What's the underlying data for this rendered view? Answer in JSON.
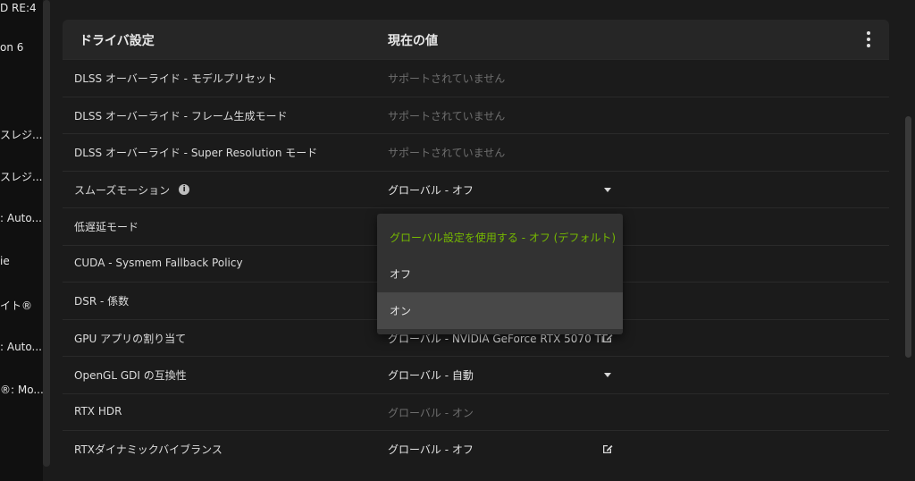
{
  "left_pane": {
    "items": [
      "D RE:4",
      "on 6",
      "スレジ...",
      "スレジ...",
      ": Auto...",
      "ie",
      "イト®",
      ": Auto...",
      "®: Mo..."
    ]
  },
  "table": {
    "header_setting": "ドライバ設定",
    "header_value": "現在の値",
    "rows": [
      {
        "label": "DLSS オーバーライド - モデルプリセット",
        "value": "サポートされていません"
      },
      {
        "label": "DLSS オーバーライド - フレーム生成モード",
        "value": "サポートされていません"
      },
      {
        "label": "DLSS オーバーライド - Super Resolution モード",
        "value": "サポートされていません"
      },
      {
        "label": "スムーズモーション",
        "value": "グローバル - オフ"
      },
      {
        "label": "低遅延モード",
        "value": ""
      },
      {
        "label": "CUDA - Sysmem Fallback Policy",
        "value": ""
      },
      {
        "label": "DSR - 係数",
        "value": ""
      },
      {
        "label": "GPU アプリの割り当て",
        "value": "グローバル - NVIDIA GeForce RTX 5070 Ti"
      },
      {
        "label": "OpenGL GDI の互換性",
        "value": "グローバル - 自動"
      },
      {
        "label": "RTX HDR",
        "value": "グローバル - オン"
      },
      {
        "label": "RTXダイナミックバイブランス",
        "value": "グローバル - オフ"
      }
    ]
  },
  "dropdown": {
    "options": [
      "グローバル設定を使用する - オフ (デフォルト)",
      "オフ",
      "オン"
    ]
  },
  "colors": {
    "accent": "#76b900",
    "background": "#1b1b1b",
    "header": "#262626",
    "muted_text": "#6e6e6e"
  },
  "icons": [
    "info-icon",
    "dropdown-arrow-icon",
    "edit-icon",
    "kebab-menu-icon"
  ]
}
